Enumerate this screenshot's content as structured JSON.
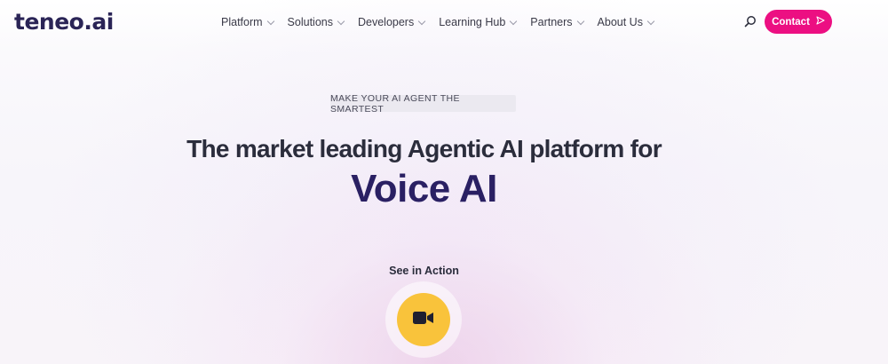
{
  "brand": {
    "logo_text": "teneo.ai"
  },
  "nav": {
    "items": [
      {
        "label": "Platform"
      },
      {
        "label": "Solutions"
      },
      {
        "label": "Developers"
      },
      {
        "label": "Learning Hub"
      },
      {
        "label": "Partners"
      },
      {
        "label": "About Us"
      }
    ]
  },
  "header": {
    "contact_label": "Contact"
  },
  "hero": {
    "tagline": "MAKE YOUR AI AGENT THE SMARTEST",
    "headline": "The market leading Agentic AI platform for",
    "headline_accent": "Voice AI",
    "see_label": "See in Action"
  },
  "icons": {
    "search": "search-icon",
    "contact_arrow": "send-arrow-icon",
    "video": "video-camera-icon",
    "nav_chevron": "chevron-down-icon"
  },
  "colors": {
    "brand_navy": "#2a2456",
    "accent_pink": "#ec0f82",
    "play_yellow": "#f9c33b",
    "accent_purple": "#2a2063"
  }
}
